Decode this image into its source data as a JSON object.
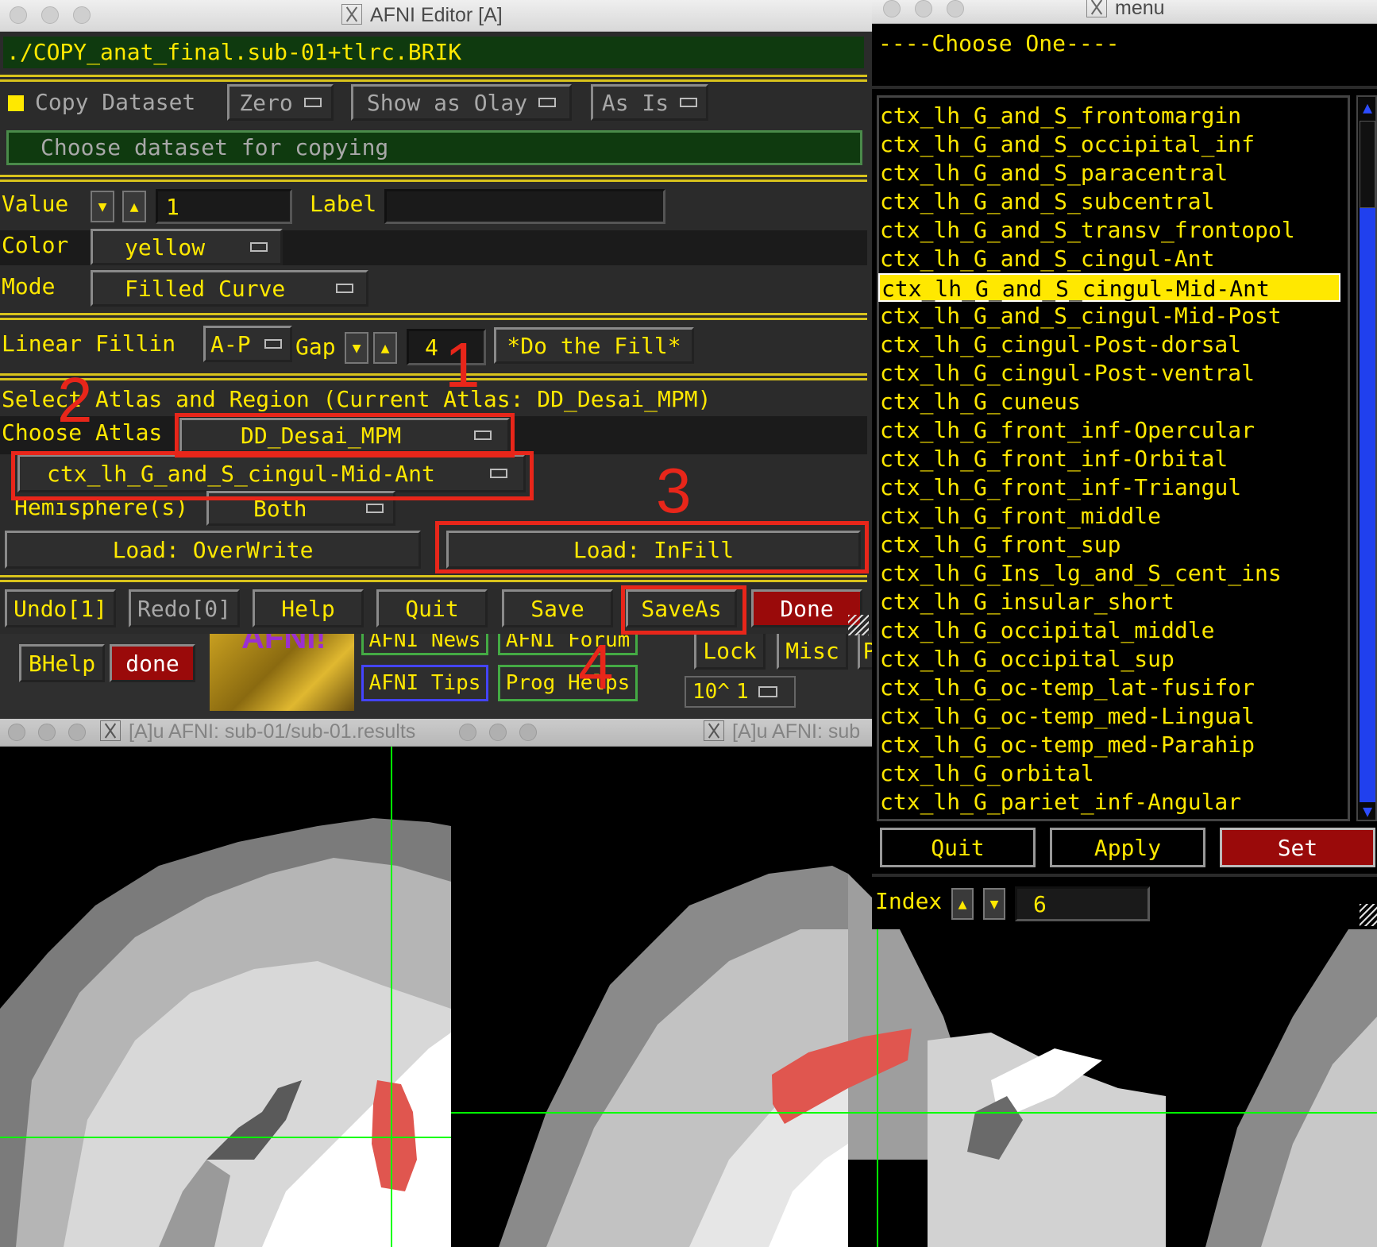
{
  "editor": {
    "window_title": "AFNI Editor [A]",
    "dataset_path": "./COPY_anat_final.sub-01+tlrc.BRIK",
    "copy_dataset_label": "Copy Dataset",
    "zero_label": "Zero",
    "show_as_olay_label": "Show as Olay",
    "as_is_label": "As Is",
    "choose_dataset_label": "Choose dataset for copying",
    "value_label": "Value",
    "value": "1",
    "label_label": "Label",
    "label_value": "",
    "color_label": "Color",
    "color_value": "yellow",
    "mode_label": "Mode",
    "mode_value": "Filled Curve",
    "linear_fillin_label": "Linear Fillin",
    "fillin_dir": "A-P",
    "gap_label": "Gap",
    "gap_value": "4",
    "do_fill_label": "*Do the Fill*",
    "atlas_heading": "Select Atlas and Region (Current Atlas: DD_Desai_MPM)",
    "choose_atlas_label": "Choose Atlas",
    "atlas_value": "DD_Desai_MPM",
    "region_value": "ctx_lh_G_and_S_cingul-Mid-Ant",
    "hemisphere_label": "Hemisphere(s)",
    "hemisphere_value": "Both",
    "load_overwrite_label": "Load: OverWrite",
    "load_infill_label": "Load: InFill",
    "bottom_buttons": {
      "undo": "Undo[1]",
      "redo": "Redo[0]",
      "help": "Help",
      "quit": "Quit",
      "save": "Save",
      "saveas": "SaveAs",
      "done": "Done"
    }
  },
  "afni_main": {
    "bhelp": "BHelp",
    "done": "done",
    "logo_text": "AFNI!",
    "news": "AFNI News",
    "forum": "AFNI Forum",
    "tips": "AFNI Tips",
    "prog_helps": "Prog Helps",
    "lock": "Lock",
    "misc": "Misc",
    "p_partial": "P",
    "power_label": "10^",
    "power_value": "1"
  },
  "viewer_titles": {
    "left": "[A]u AFNI: sub-01/sub-01.results",
    "right": "[A]u AFNI: sub"
  },
  "menu": {
    "window_title": "menu",
    "heading": "----Choose One----",
    "items": [
      "ctx_lh_G_and_S_frontomargin",
      "ctx_lh_G_and_S_occipital_inf",
      "ctx_lh_G_and_S_paracentral",
      "ctx_lh_G_and_S_subcentral",
      "ctx_lh_G_and_S_transv_frontopol",
      "ctx_lh_G_and_S_cingul-Ant",
      "ctx_lh_G_and_S_cingul-Mid-Ant",
      "ctx_lh_G_and_S_cingul-Mid-Post",
      "ctx_lh_G_cingul-Post-dorsal",
      "ctx_lh_G_cingul-Post-ventral",
      "ctx_lh_G_cuneus",
      "ctx_lh_G_front_inf-Opercular",
      "ctx_lh_G_front_inf-Orbital",
      "ctx_lh_G_front_inf-Triangul",
      "ctx_lh_G_front_middle",
      "ctx_lh_G_front_sup",
      "ctx_lh_G_Ins_lg_and_S_cent_ins",
      "ctx_lh_G_insular_short",
      "ctx_lh_G_occipital_middle",
      "ctx_lh_G_occipital_sup",
      "ctx_lh_G_oc-temp_lat-fusifor",
      "ctx_lh_G_oc-temp_med-Lingual",
      "ctx_lh_G_oc-temp_med-Parahip",
      "ctx_lh_G_orbital",
      "ctx_lh_G_pariet_inf-Angular"
    ],
    "selected_index": 6,
    "quit_label": "Quit",
    "apply_label": "Apply",
    "set_label": "Set",
    "index_label": "Index",
    "index_value": "6"
  },
  "annotations": [
    "1",
    "2",
    "3",
    "4"
  ],
  "colors": {
    "accent_yellow": "#ffe800",
    "annotation_red": "#e8261a",
    "roi_red": "#e0564f",
    "crosshair_green": "#00ff00",
    "done_red": "#9a0a0a"
  }
}
